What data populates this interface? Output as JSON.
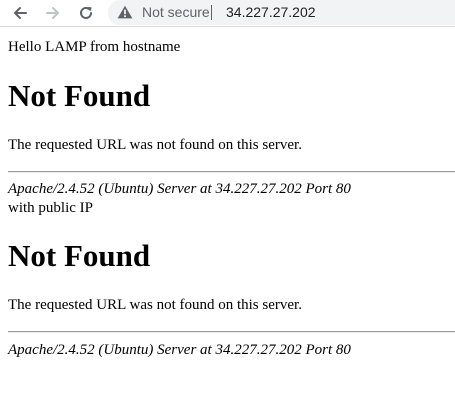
{
  "browser": {
    "security_label": "Not secure",
    "url": "34.227.27.202",
    "icons": {
      "back": "back-arrow-icon",
      "forward": "forward-arrow-icon",
      "reload": "reload-icon",
      "security": "warning-triangle-icon"
    }
  },
  "page": {
    "greeting": "Hello LAMP from hostname",
    "first_error": {
      "title": "Not Found",
      "message": "The requested URL was not found on this server.",
      "signature": "Apache/2.4.52 (Ubuntu) Server at 34.227.27.202 Port 80"
    },
    "between_text": "with public IP",
    "second_error": {
      "title": "Not Found",
      "message": "The requested URL was not found on this server.",
      "signature": "Apache/2.4.52 (Ubuntu) Server at 34.227.27.202 Port 80"
    }
  }
}
